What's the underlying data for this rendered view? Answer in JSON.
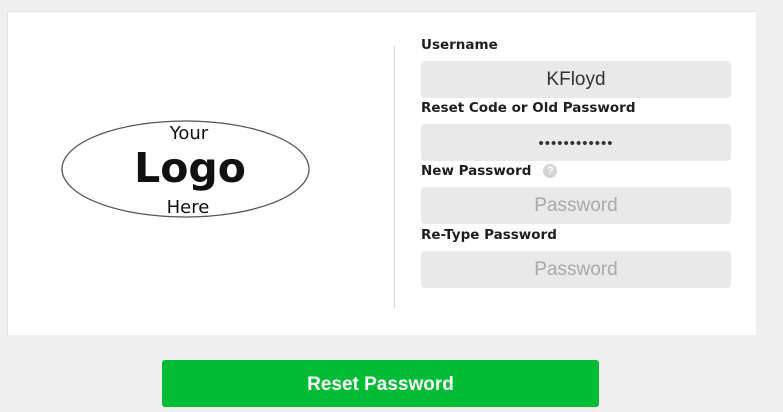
{
  "logo": {
    "line1": "Your",
    "line2": "Logo",
    "line3": "Here"
  },
  "form": {
    "username": {
      "label": "Username",
      "value": "KFloyd"
    },
    "reset_code": {
      "label": "Reset Code or Old Password",
      "value": "••••••••••••"
    },
    "new_password": {
      "label": "New Password",
      "placeholder": "Password",
      "help_icon": "question-circle-icon",
      "help_glyph": "?"
    },
    "retype_password": {
      "label": "Re-Type Password",
      "placeholder": "Password"
    }
  },
  "actions": {
    "reset_label": "Reset Password"
  },
  "colors": {
    "primary_button": "#00bc35",
    "field_background": "#e9e9e9",
    "page_background": "#f0f0f0"
  }
}
